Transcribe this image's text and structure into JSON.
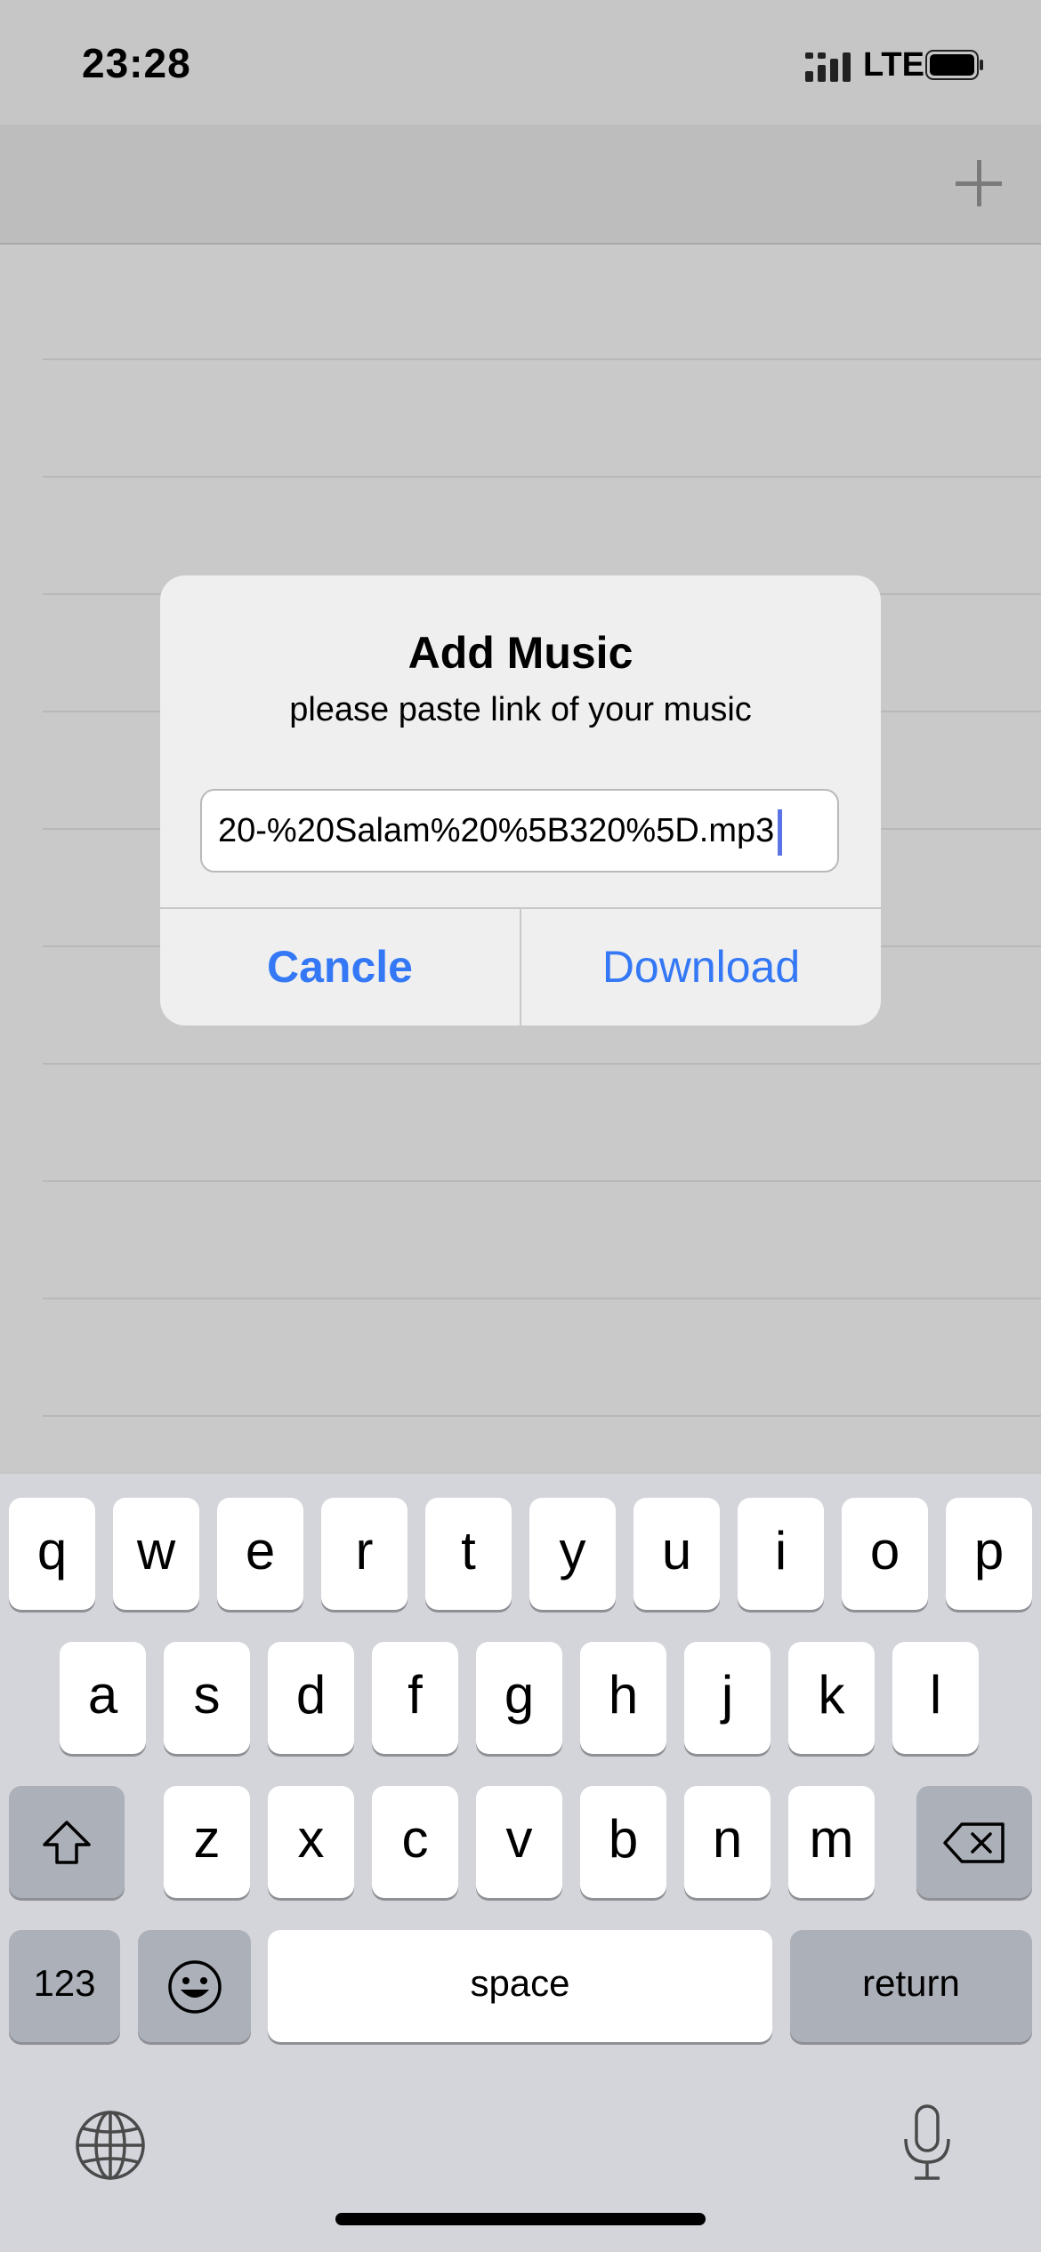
{
  "status": {
    "time": "23:28",
    "network": "LTE"
  },
  "alert": {
    "title": "Add Music",
    "message": "please paste link of your music",
    "input_value": "20-%20Salam%20%5B320%5D.mp3",
    "cancel_label": "Cancle",
    "download_label": "Download"
  },
  "keyboard": {
    "row1": [
      "q",
      "w",
      "e",
      "r",
      "t",
      "y",
      "u",
      "i",
      "o",
      "p"
    ],
    "row2": [
      "a",
      "s",
      "d",
      "f",
      "g",
      "h",
      "j",
      "k",
      "l"
    ],
    "row3": [
      "z",
      "x",
      "c",
      "v",
      "b",
      "n",
      "m"
    ],
    "numbers_label": "123",
    "space_label": "space",
    "return_label": "return"
  },
  "colors": {
    "accent": "#3478f6",
    "caret": "#5a74e6"
  },
  "icons": [
    "signal-icon",
    "battery-icon",
    "add-icon",
    "shift-icon",
    "delete-icon",
    "emoji-icon",
    "globe-icon",
    "microphone-icon"
  ]
}
